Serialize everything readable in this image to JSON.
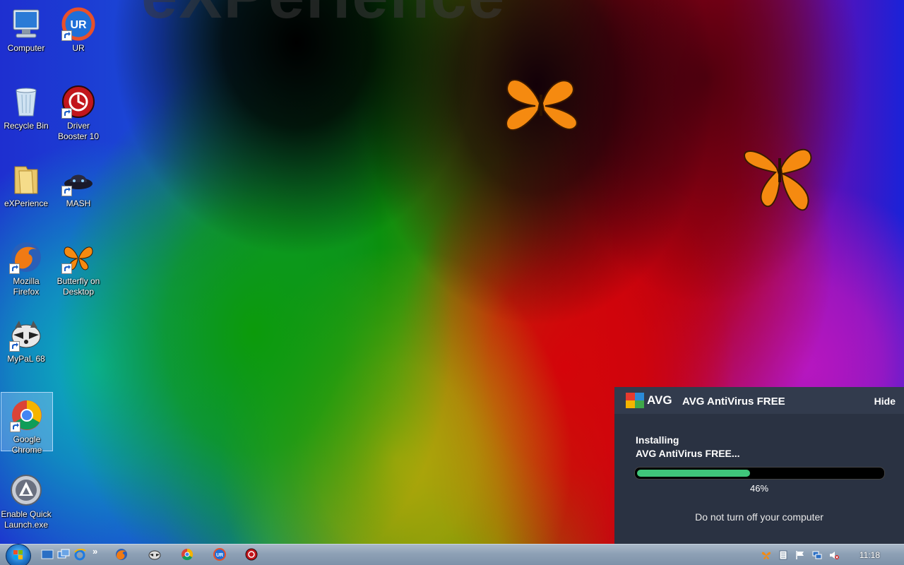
{
  "wallpaper": {
    "text": "eXPerience"
  },
  "desktop_icons": [
    {
      "label": "Computer"
    },
    {
      "label": "UR"
    },
    {
      "label": "Recycle Bin"
    },
    {
      "label": "Driver Booster 10"
    },
    {
      "label": "eXPerience"
    },
    {
      "label": "MASH"
    },
    {
      "label": "Mozilla Firefox"
    },
    {
      "label": "Butterfly on Desktop"
    },
    {
      "label": "MyPaL 68"
    },
    {
      "label": "Google Chrome"
    },
    {
      "label": "Enable Quick Launch.exe"
    }
  ],
  "avg_popup": {
    "logo": "AVG",
    "title": "AVG AntiVirus FREE",
    "hide_label": "Hide",
    "status_line1": "Installing",
    "status_line2": "AVG AntiVirus FREE...",
    "progress_percent": 46,
    "progress_label": "46%",
    "note": "Do not turn off your computer",
    "colors": {
      "background": "#2a3242",
      "progress": "#3fc67a"
    }
  },
  "taskbar": {
    "quick_launch_more": "»",
    "clock": "11:18"
  }
}
